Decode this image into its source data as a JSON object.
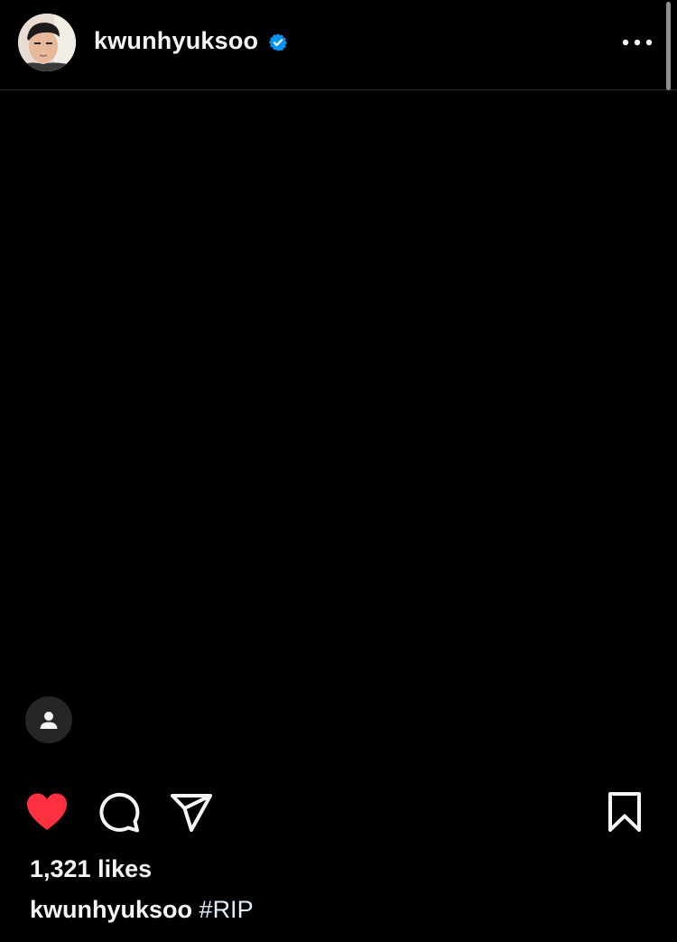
{
  "header": {
    "username": "kwunhyuksoo",
    "verified": true,
    "verified_color": "#0095f6",
    "avatar_icon": "profile-photo",
    "more_icon": "more-horizontal-icon"
  },
  "media": {
    "background": "#000000",
    "tag_icon": "user-tag-icon"
  },
  "actions": {
    "like_icon": "heart-filled-icon",
    "like_color": "#ff3040",
    "comment_icon": "comment-icon",
    "share_icon": "send-icon",
    "save_icon": "bookmark-icon"
  },
  "likes_text": "1,321 likes",
  "caption": {
    "username": "kwunhyuksoo",
    "hashtag": "#RIP"
  }
}
